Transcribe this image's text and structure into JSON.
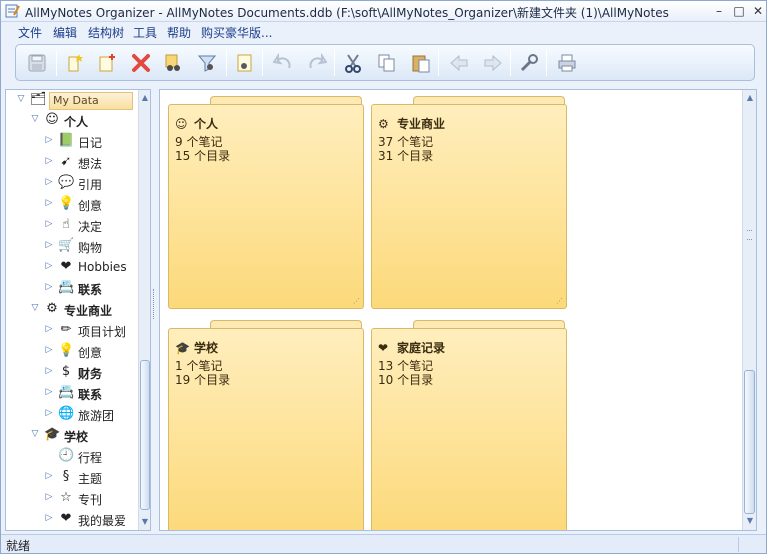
{
  "window": {
    "title": "AllMyNotes Organizer - AllMyNotes Documents.ddb (F:\\soft\\AllMyNotes_Organizer\\新建文件夹 (1)\\AllMyNotes Do",
    "min_glyph": "–",
    "max_glyph": "□",
    "close_glyph": "✕"
  },
  "menu": [
    "文件",
    "编辑",
    "结构树",
    "工具",
    "帮助",
    "购买豪华版..."
  ],
  "toolbar": {
    "buttons": [
      {
        "icon": "save-icon",
        "glyph": "💾"
      },
      {
        "icon": "new-note-star-icon",
        "glyph": "✎"
      },
      {
        "icon": "new-page-plus-icon",
        "glyph": "📄"
      },
      {
        "icon": "delete-x-icon",
        "glyph": "✖"
      },
      {
        "icon": "find-binoculars-icon",
        "glyph": "🔭"
      },
      {
        "icon": "filter-icon",
        "glyph": "⛛"
      },
      {
        "icon": "page-search-icon",
        "glyph": "🔍"
      },
      {
        "icon": "undo-icon",
        "glyph": "↶"
      },
      {
        "icon": "redo-icon",
        "glyph": "↷"
      },
      {
        "icon": "cut-scissors-icon",
        "glyph": "✂"
      },
      {
        "icon": "copy-icon",
        "glyph": "❐"
      },
      {
        "icon": "paste-icon",
        "glyph": "📋"
      },
      {
        "icon": "back-arrow-icon",
        "glyph": "⇦"
      },
      {
        "icon": "forward-arrow-icon",
        "glyph": "⇨"
      },
      {
        "icon": "tools-wrench-icon",
        "glyph": "🔧"
      },
      {
        "icon": "print-icon",
        "glyph": "🖨"
      }
    ]
  },
  "tree": {
    "root": "My Data",
    "nodes": [
      {
        "label": "个人",
        "level": 1,
        "bold": true,
        "icon": "smiley-icon",
        "glyph": "☺",
        "expand": "▽"
      },
      {
        "label": "日记",
        "level": 2,
        "bold": false,
        "icon": "book-icon",
        "glyph": "📗",
        "expand": "▷"
      },
      {
        "label": "想法",
        "level": 2,
        "bold": false,
        "icon": "idea-arrow-icon",
        "glyph": "➹",
        "expand": "▷"
      },
      {
        "label": "引用",
        "level": 2,
        "bold": false,
        "icon": "speech-bubble-icon",
        "glyph": "💬",
        "expand": "▷"
      },
      {
        "label": "创意",
        "level": 2,
        "bold": false,
        "icon": "lightbulb-icon",
        "glyph": "💡",
        "expand": "▷"
      },
      {
        "label": "决定",
        "level": 2,
        "bold": false,
        "icon": "pointing-hand-icon",
        "glyph": "☝",
        "expand": "▷"
      },
      {
        "label": "购物",
        "level": 2,
        "bold": false,
        "icon": "shopping-cart-icon",
        "glyph": "🛒",
        "expand": "▷"
      },
      {
        "label": "Hobbies",
        "level": 2,
        "bold": false,
        "icon": "heart-icon",
        "glyph": "❤",
        "expand": "▷"
      },
      {
        "label": "联系",
        "level": 2,
        "bold": true,
        "icon": "contact-card-icon",
        "glyph": "📇",
        "expand": "▷"
      },
      {
        "label": "专业商业",
        "level": 1,
        "bold": true,
        "icon": "business-icon",
        "glyph": "⚙",
        "expand": "▽"
      },
      {
        "label": "项目计划",
        "level": 2,
        "bold": false,
        "icon": "pencil-ruler-icon",
        "glyph": "✏",
        "expand": "▷"
      },
      {
        "label": "创意",
        "level": 2,
        "bold": false,
        "icon": "lightbulb-icon",
        "glyph": "💡",
        "expand": "▷"
      },
      {
        "label": "财务",
        "level": 2,
        "bold": true,
        "icon": "dollar-icon",
        "glyph": "$",
        "expand": "▷"
      },
      {
        "label": "联系",
        "level": 2,
        "bold": true,
        "icon": "contact-card-icon",
        "glyph": "📇",
        "expand": "▷"
      },
      {
        "label": "旅游团",
        "level": 2,
        "bold": false,
        "icon": "globe-icon",
        "glyph": "🌐",
        "expand": "▷"
      },
      {
        "label": "学校",
        "level": 1,
        "bold": true,
        "icon": "graduation-cap-icon",
        "glyph": "🎓",
        "expand": "▽"
      },
      {
        "label": "行程",
        "level": 2,
        "bold": false,
        "icon": "clock-icon",
        "glyph": "🕘",
        "expand": ""
      },
      {
        "label": "主题",
        "level": 2,
        "bold": false,
        "icon": "topic-icon",
        "glyph": "§",
        "expand": "▷"
      },
      {
        "label": "专刊",
        "level": 2,
        "bold": false,
        "icon": "star-icon",
        "glyph": "☆",
        "expand": "▷"
      },
      {
        "label": "我的最爱",
        "level": 2,
        "bold": false,
        "icon": "heart-icon",
        "glyph": "❤",
        "expand": "▷"
      }
    ]
  },
  "folders": [
    {
      "title": "个人",
      "notes": "9 个笔记",
      "dirs": "15 个目录",
      "icon": "smiley-icon",
      "glyph": "☺"
    },
    {
      "title": "专业商业",
      "notes": "37 个笔记",
      "dirs": "31 个目录",
      "icon": "business-icon",
      "glyph": "⚙"
    },
    {
      "title": "学校",
      "notes": "1 个笔记",
      "dirs": "19 个目录",
      "icon": "graduation-cap-icon",
      "glyph": "🎓"
    },
    {
      "title": "家庭记录",
      "notes": "13 个笔记",
      "dirs": "10 个目录",
      "icon": "heart-icon",
      "glyph": "❤"
    }
  ],
  "status": {
    "text": "就绪"
  },
  "colors": {
    "accent": "#1c3f8a",
    "folder": "#fcd97a",
    "selection": "#f9df9f"
  }
}
